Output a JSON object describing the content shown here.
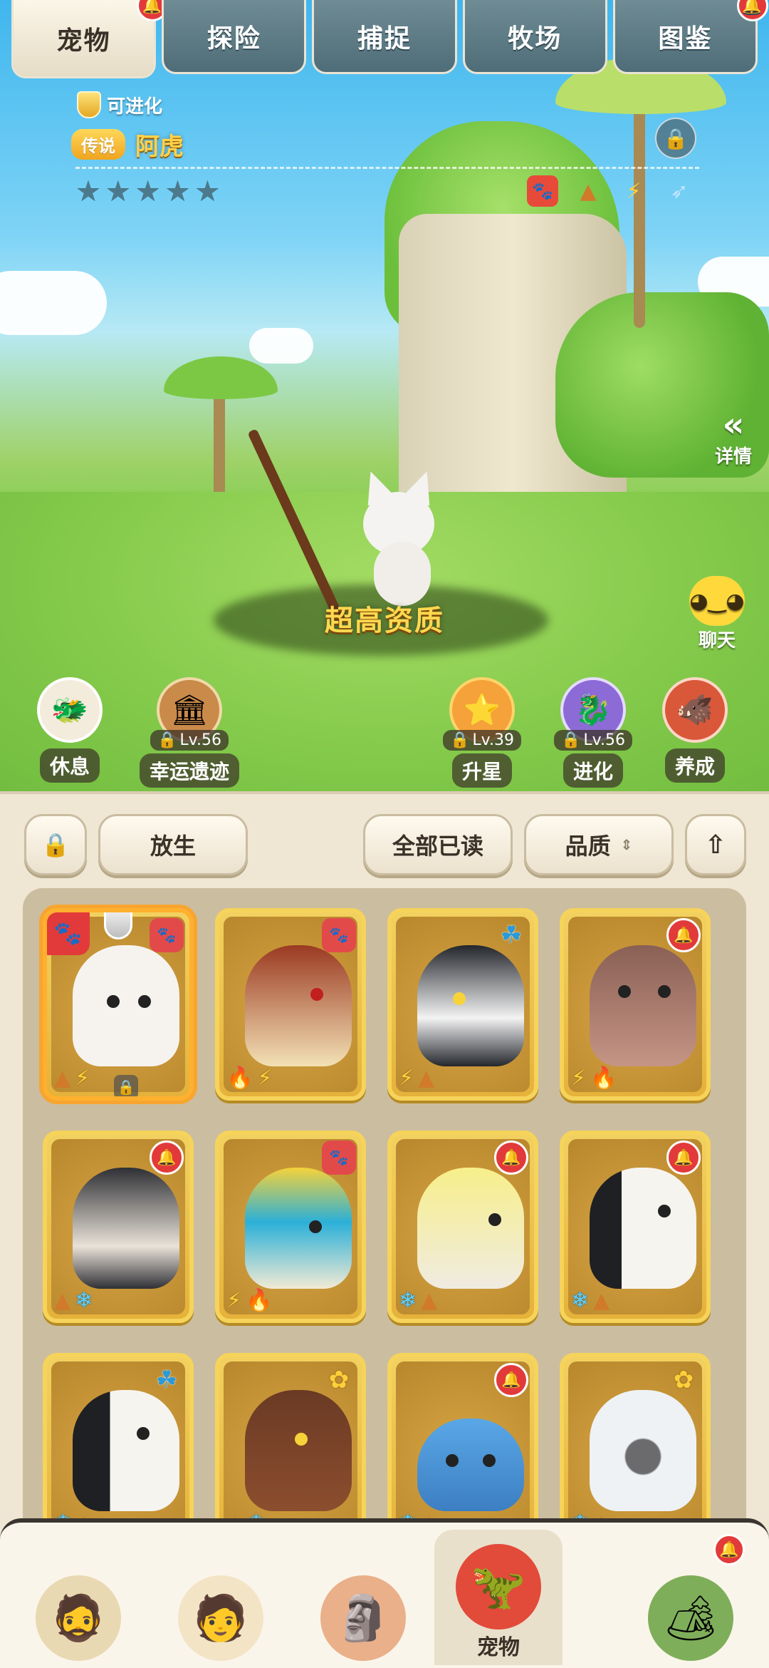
{
  "tabs": [
    {
      "label": "宠物",
      "active": true
    },
    {
      "label": "探险",
      "active": false
    },
    {
      "label": "捕捉",
      "active": false
    },
    {
      "label": "牧场",
      "active": false
    },
    {
      "label": "图鉴",
      "active": false
    }
  ],
  "pet": {
    "evolve_tag": "可进化",
    "rarity": "传说",
    "name": "阿虎",
    "stars": 5,
    "quality_text": "超高资质"
  },
  "side": {
    "details_label": "详情",
    "chat_label": "聊天"
  },
  "actions": [
    {
      "label": "休息",
      "icon": "sleeping-dragon-icon",
      "locked": false,
      "level": ""
    },
    {
      "label": "幸运遗迹",
      "icon": "ruins-icon",
      "locked": true,
      "level": "Lv.56"
    },
    {
      "label": "升星",
      "icon": "star-crown-icon",
      "locked": true,
      "level": "Lv.39"
    },
    {
      "label": "进化",
      "icon": "evolve-pet-icon",
      "locked": true,
      "level": "Lv.56"
    },
    {
      "label": "养成",
      "icon": "boar-icon",
      "locked": false,
      "level": ""
    }
  ],
  "toolbar": {
    "release_label": "放生",
    "mark_all_read_label": "全部已读",
    "sort_label": "品质"
  },
  "pets": [
    {
      "name": "white-cat",
      "badge": "paw",
      "elements": [
        "ground",
        "bolt"
      ],
      "selected": true
    },
    {
      "name": "fire-penguin",
      "badge": "paw",
      "elements": [
        "fire",
        "bolt"
      ],
      "selected": false
    },
    {
      "name": "black-wolf",
      "badge": "leaf",
      "elements": [
        "bolt",
        "ground"
      ],
      "selected": false
    },
    {
      "name": "rhino-pig",
      "badge": "bell",
      "elements": [
        "bolt",
        "fire"
      ],
      "selected": false
    },
    {
      "name": "rock-turtle",
      "badge": "bell",
      "elements": [
        "ground",
        "ice"
      ],
      "selected": false
    },
    {
      "name": "blue-dragon",
      "badge": "paw",
      "elements": [
        "bolt",
        "fire"
      ],
      "selected": false
    },
    {
      "name": "yellow-duck",
      "badge": "bell",
      "elements": [
        "ice",
        "ground"
      ],
      "selected": false
    },
    {
      "name": "puffin",
      "badge": "bell",
      "elements": [
        "ice",
        "ground"
      ],
      "selected": false
    },
    {
      "name": "puffin-2",
      "badge": "leaf",
      "elements": [
        "ice",
        "ground"
      ],
      "selected": false
    },
    {
      "name": "brown-dino",
      "badge": "gold",
      "elements": [
        "ground",
        "ice"
      ],
      "selected": false
    },
    {
      "name": "blue-whale",
      "badge": "bell",
      "elements": [
        "ice",
        "ground"
      ],
      "selected": false
    },
    {
      "name": "yeti",
      "badge": "gold",
      "elements": [
        "ice",
        "ground"
      ],
      "selected": false
    }
  ],
  "bottom_nav": [
    {
      "label": "",
      "icon": "tribe-chief-icon"
    },
    {
      "label": "",
      "icon": "caveman-icon"
    },
    {
      "label": "",
      "icon": "totem-icon"
    },
    {
      "label": "宠物",
      "icon": "pet-dino-icon",
      "active": true
    },
    {
      "label": "",
      "icon": "shop-icon"
    }
  ],
  "colors": {
    "tab_active": "#fbf6e8",
    "tab_inactive": "#5e7c87",
    "gold_text": "#ffd24a",
    "card_gold": "#f2d160",
    "alert_red": "#e23a3a"
  }
}
